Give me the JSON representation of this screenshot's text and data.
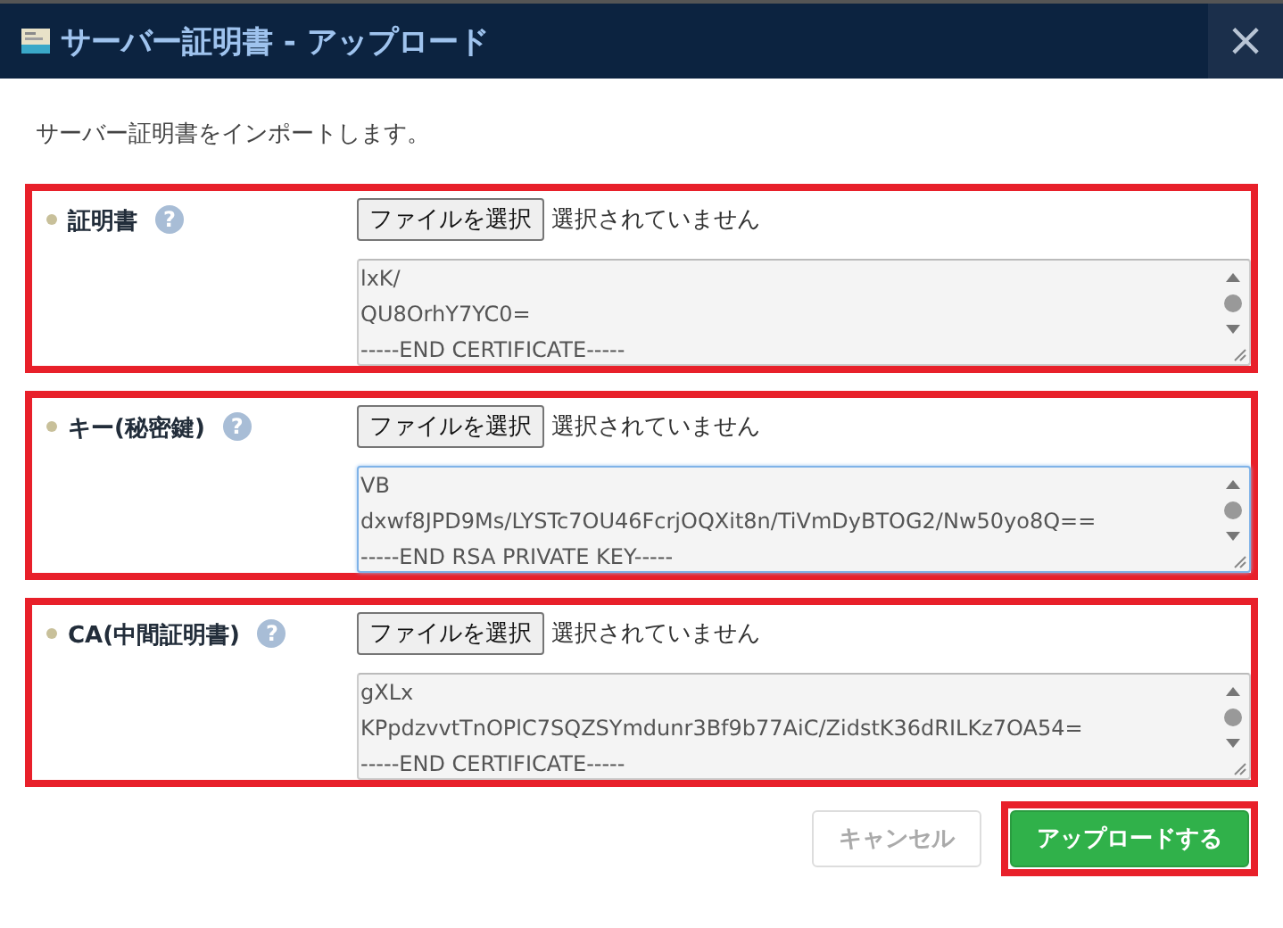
{
  "window": {
    "title": "サーバー証明書 - アップロード",
    "close": "×"
  },
  "description": "サーバー証明書をインポートします。",
  "sections": [
    {
      "label": "証明書",
      "help": "?",
      "file_button": "ファイルを選択",
      "file_status": "選択されていません",
      "value": "lxK/\nQU8OrhY7YC0=\n-----END CERTIFICATE-----",
      "focused": false,
      "highlighted": true
    },
    {
      "label": "キー(秘密鍵)",
      "help": "?",
      "file_button": "ファイルを選択",
      "file_status": "選択されていません",
      "value": "VB\ndxwf8JPD9Ms/LYSTc7OU46FcrjOQXit8n/TiVmDyBTOG2/Nw50yo8Q==\n-----END RSA PRIVATE KEY-----",
      "focused": true,
      "highlighted": true
    },
    {
      "label": "CA(中間証明書)",
      "help": "?",
      "file_button": "ファイルを選択",
      "file_status": "選択されていません",
      "value": "gXLx\nKPpdzvvtTnOPlC7SQZSYmdunr3Bf9b77AiC/ZidstK36dRILKz7OA54=\n-----END CERTIFICATE-----",
      "focused": false,
      "highlighted": true
    }
  ],
  "buttons": [
    {
      "kind": "cancel",
      "label": "キャンセル",
      "disabled": true,
      "highlighted": false
    },
    {
      "kind": "primary",
      "label": "アップロードする",
      "disabled": false,
      "highlighted": true
    }
  ]
}
